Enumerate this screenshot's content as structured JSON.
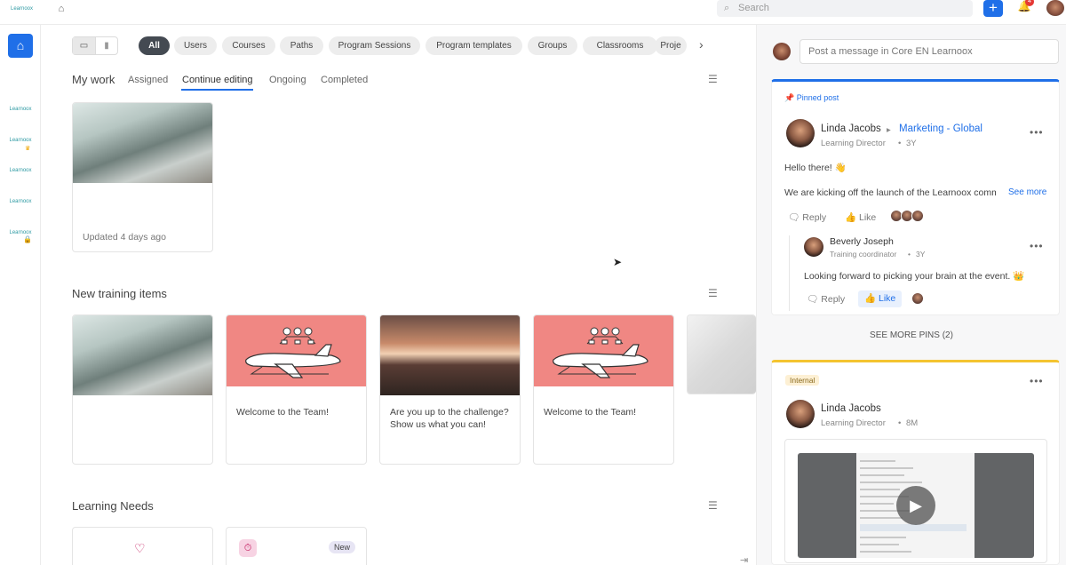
{
  "topbar": {
    "logo_text": "Learnoox",
    "search_placeholder": "Search",
    "notifications_count": "4",
    "icons": {
      "home": "home-icon",
      "search": "search-icon",
      "add": "plus-icon",
      "bell": "bell-icon"
    }
  },
  "sidebar": {
    "items": [
      "Learnoox",
      "Learnoox",
      "Learnoox",
      "Learnoox",
      "Learnoox"
    ]
  },
  "filters": {
    "chips": [
      "All",
      "Users",
      "Courses",
      "Paths",
      "Program Sessions",
      "Program templates",
      "Groups",
      "Classrooms",
      "Proje"
    ],
    "active": "All"
  },
  "my_work": {
    "title": "My work",
    "tabs": [
      "Assigned",
      "Continue editing",
      "Ongoing",
      "Completed"
    ],
    "active_tab": "Continue editing",
    "card_updated": "Updated 4 days ago"
  },
  "new_training": {
    "title": "New training items",
    "cards": [
      {
        "text": ""
      },
      {
        "text": "Welcome to the Team!"
      },
      {
        "text": "Are you up to the challenge? Show us what you can!"
      },
      {
        "text": "Welcome to the Team!"
      },
      {
        "text": ""
      }
    ]
  },
  "learning_needs": {
    "title": "Learning Needs",
    "badge": "New"
  },
  "feed": {
    "composer_placeholder": "Post a message in Core EN Learnoox",
    "pinned_label": "Pinned post",
    "post1": {
      "author": "Linda Jacobs",
      "group": "Marketing - Global",
      "role": "Learning Director",
      "age": "3Y",
      "greeting": "Hello there! 👋",
      "body": "We are kicking off the launch of the Learnoox community",
      "see_more": "See more",
      "reply_label": "Reply",
      "like_label": "Like"
    },
    "reply1": {
      "author": "Beverly Joseph",
      "role": "Training coordinator",
      "age": "3Y",
      "body": "Looking forward to picking your brain at the event. 👑",
      "reply_label": "Reply",
      "like_label": "Like"
    },
    "see_more_pins": "SEE MORE PINS (2)",
    "post2": {
      "tag": "Internal",
      "author": "Linda Jacobs",
      "role": "Learning Director",
      "age": "8M"
    }
  },
  "colors": {
    "accent": "#1f6fe8",
    "pinned_bar": "#1f6fe8",
    "internal_bar": "#f4c430",
    "plane_bg": "#f08783"
  }
}
